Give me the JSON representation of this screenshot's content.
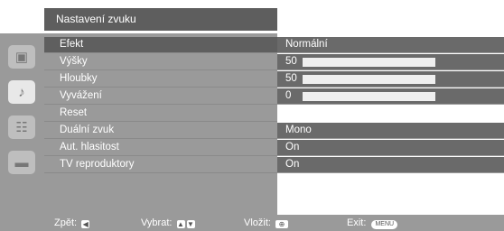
{
  "title": "Nastavení zvuku",
  "tabs": [
    {
      "icon": "picture-icon",
      "glyph": "▣",
      "active": false
    },
    {
      "icon": "music-note-icon",
      "glyph": "♪",
      "active": true
    },
    {
      "icon": "channel-list-icon",
      "glyph": "☷",
      "active": false
    },
    {
      "icon": "toolbox-icon",
      "glyph": "▬",
      "active": false
    }
  ],
  "rows": [
    {
      "label": "Efekt",
      "value": "Normální",
      "level": null,
      "selected": true
    },
    {
      "label": "Výšky",
      "value": "50",
      "level": 0.5,
      "selected": false
    },
    {
      "label": "Hloubky",
      "value": "50",
      "level": 0.5,
      "selected": false
    },
    {
      "label": "Vyvážení",
      "value": "0",
      "level": 0.5,
      "selected": false
    },
    {
      "label": "Reset",
      "value": "",
      "level": null,
      "selected": false
    },
    {
      "label": "Duální zvuk",
      "value": "Mono",
      "level": null,
      "selected": false
    },
    {
      "label": "Aut. hlasitost",
      "value": "On",
      "level": null,
      "selected": false
    },
    {
      "label": "TV reproduktory",
      "value": "On",
      "level": null,
      "selected": false
    }
  ],
  "footer": {
    "back_label": "Zpět:",
    "select_label": "Vybrat:",
    "enter_label": "Vložit:",
    "exit_label": "Exit:",
    "menu_key": "MENU"
  }
}
